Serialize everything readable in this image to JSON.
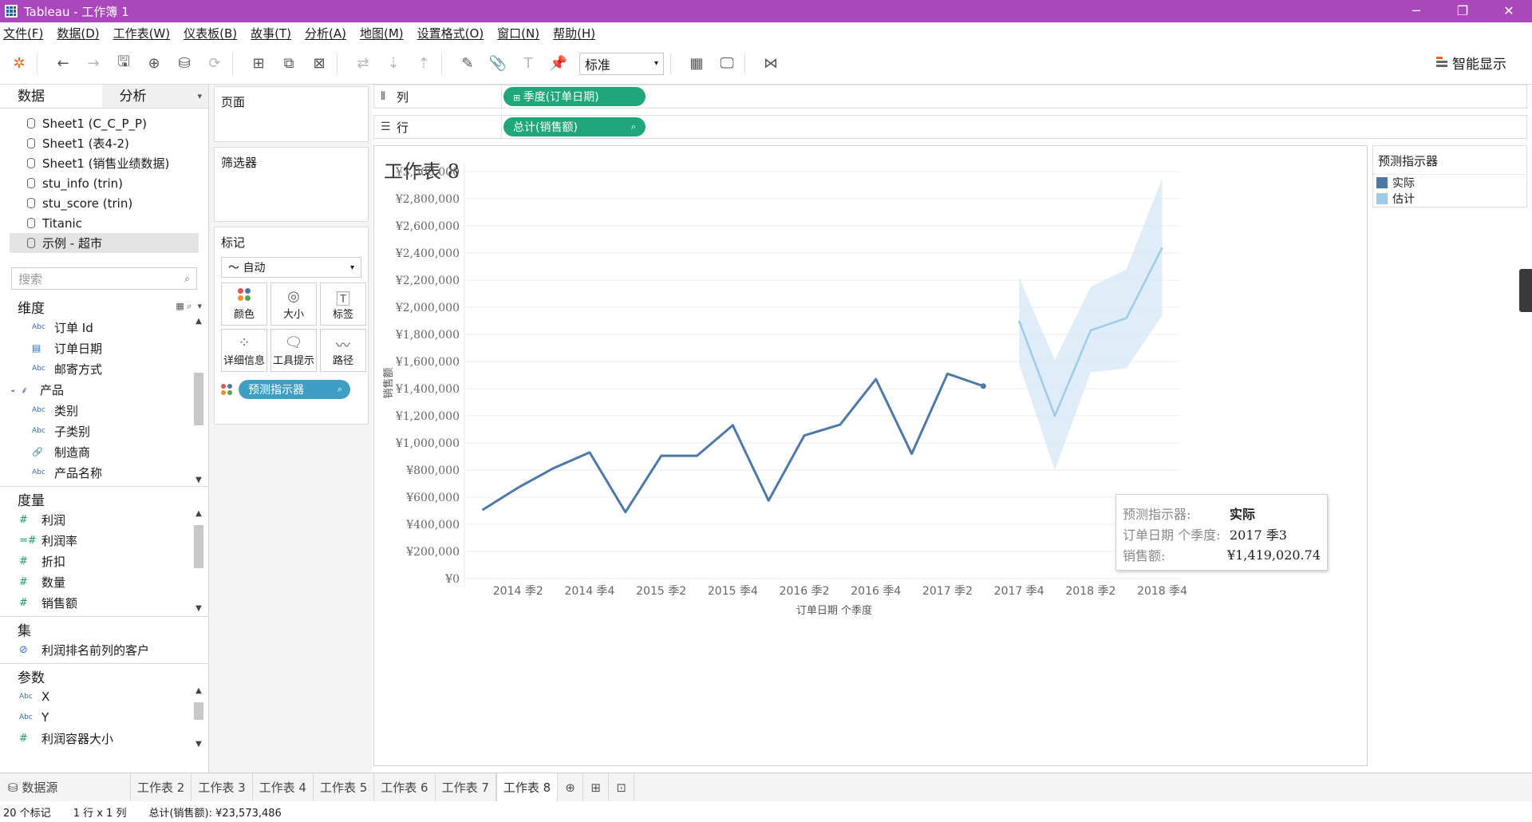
{
  "window": {
    "title": "Tableau - 工作簿 1",
    "controls": [
      "─",
      "❐",
      "✕"
    ]
  },
  "menu": [
    "文件(F)",
    "数据(D)",
    "工作表(W)",
    "仪表板(B)",
    "故事(T)",
    "分析(A)",
    "地图(M)",
    "设置格式(O)",
    "窗口(N)",
    "帮助(H)"
  ],
  "toolbar": {
    "fit_value": "标准",
    "show_me": "智能显示"
  },
  "data_pane": {
    "tabs": [
      "数据",
      "分析"
    ],
    "datasources": [
      "Sheet1 (C_C_P_P)",
      "Sheet1 (表4-2)",
      "Sheet1 (销售业绩数据)",
      "stu_info (trin)",
      "stu_score (trin)",
      "Titanic",
      "示例 - 超市"
    ],
    "search_placeholder": "搜索",
    "dimensions_header": "维度",
    "dimensions": [
      {
        "type": "Abc",
        "label": "订单 Id"
      },
      {
        "type": "▤",
        "label": "订单日期"
      },
      {
        "type": "Abc",
        "label": "邮寄方式"
      },
      {
        "type": "⸙",
        "label": "产品"
      },
      {
        "type": "Abc",
        "label": "类别"
      },
      {
        "type": "Abc",
        "label": "子类别"
      },
      {
        "type": "🔗",
        "label": "制造商"
      },
      {
        "type": "Abc",
        "label": "产品名称"
      }
    ],
    "measures_header": "度量",
    "measures": [
      {
        "type": "#",
        "label": "利润"
      },
      {
        "type": "=#",
        "label": "利润率"
      },
      {
        "type": "#",
        "label": "折扣"
      },
      {
        "type": "#",
        "label": "数量"
      },
      {
        "type": "#",
        "label": "销售额"
      }
    ],
    "sets_header": "集",
    "sets": [
      "利润排名前列的客户"
    ],
    "params_header": "参数",
    "params": [
      {
        "type": "Abc",
        "label": "X"
      },
      {
        "type": "Abc",
        "label": "Y"
      },
      {
        "type": "#",
        "label": "利润容器大小"
      }
    ]
  },
  "cards": {
    "pages": "页面",
    "filters": "筛选器",
    "marks": "标记",
    "mark_type": "自动",
    "mark_buttons": [
      "颜色",
      "大小",
      "标签",
      "详细信息",
      "工具提示",
      "路径"
    ],
    "mark_pill": "预测指示器"
  },
  "shelves": {
    "columns_label": "列",
    "columns_pill": "季度(订单日期)",
    "rows_label": "行",
    "rows_pill": "总计(销售额)"
  },
  "view": {
    "title": "工作表 8"
  },
  "legend": {
    "title": "预测指示器",
    "items": [
      {
        "label": "实际",
        "color": "#4e79a7"
      },
      {
        "label": "估计",
        "color": "#a0cbe8"
      }
    ]
  },
  "tooltip": {
    "rows": [
      {
        "k": "预测指示器:",
        "v": "实际"
      },
      {
        "k": "订单日期 个季度:",
        "v": "2017 季3"
      },
      {
        "k": "销售额:",
        "v": "¥1,419,020.74"
      }
    ]
  },
  "chart_data": {
    "type": "line",
    "xlabel": "订单日期 个季度",
    "ylabel": "销售额",
    "ylim": [
      0,
      3000000
    ],
    "y_ticks": [
      "¥3,000,000",
      "¥2,800,000",
      "¥2,600,000",
      "¥2,400,000",
      "¥2,200,000",
      "¥2,000,000",
      "¥1,800,000",
      "¥1,600,000",
      "¥1,400,000",
      "¥1,200,000",
      "¥1,000,000",
      "¥800,000",
      "¥600,000",
      "¥400,000",
      "¥200,000",
      "¥0"
    ],
    "x_ticks": [
      "2014 季2",
      "2014 季4",
      "2015 季2",
      "2015 季4",
      "2016 季2",
      "2016 季4",
      "2017 季2",
      "2017 季4",
      "2018 季2",
      "2018 季4"
    ],
    "categories": [
      "2014 季1",
      "2014 季2",
      "2014 季3",
      "2014 季4",
      "2015 季1",
      "2015 季2",
      "2015 季3",
      "2015 季4",
      "2016 季1",
      "2016 季2",
      "2016 季3",
      "2016 季4",
      "2017 季1",
      "2017 季2",
      "2017 季3",
      "2017 季4",
      "2018 季1",
      "2018 季2",
      "2018 季3",
      "2018 季4"
    ],
    "series": [
      {
        "name": "实际",
        "color": "#4e79a7",
        "values": [
          505000,
          670000,
          815000,
          930000,
          490000,
          905000,
          905000,
          1130000,
          575000,
          1055000,
          1135000,
          1470000,
          920000,
          1510000,
          1419021,
          null,
          null,
          null,
          null,
          null
        ]
      },
      {
        "name": "估计",
        "color": "#a0cbe8",
        "values": [
          null,
          null,
          null,
          null,
          null,
          null,
          null,
          null,
          null,
          null,
          null,
          null,
          null,
          null,
          null,
          1900000,
          1200000,
          1830000,
          1920000,
          2440000
        ],
        "upper": [
          null,
          null,
          null,
          null,
          null,
          null,
          null,
          null,
          null,
          null,
          null,
          null,
          null,
          null,
          null,
          2220000,
          1610000,
          2150000,
          2280000,
          2950000
        ],
        "lower": [
          null,
          null,
          null,
          null,
          null,
          null,
          null,
          null,
          null,
          null,
          null,
          null,
          null,
          null,
          null,
          1580000,
          800000,
          1520000,
          1550000,
          1940000
        ]
      }
    ],
    "grid": true,
    "legend": "right"
  },
  "sheet_tabs": {
    "datasource": "数据源",
    "sheets": [
      "工作表 2",
      "工作表 3",
      "工作表 4",
      "工作表 5",
      "工作表 6",
      "工作表 7",
      "工作表 8"
    ],
    "active": "工作表 8"
  },
  "status": {
    "marks": "20 个标记",
    "dims": "1 行 x 1 列",
    "sum": "总计(销售额): ¥23,573,486"
  }
}
